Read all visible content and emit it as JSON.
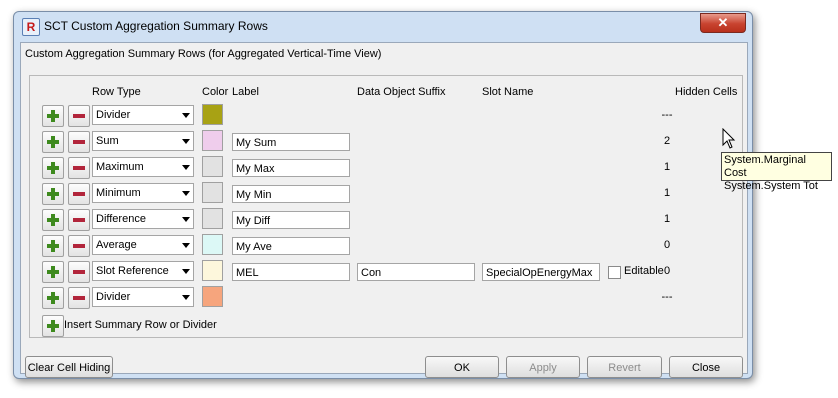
{
  "window": {
    "title": "SCT Custom Aggregation Summary Rows",
    "close_glyph": "✕",
    "app_icon_glyph": "R"
  },
  "subtitle": "Custom Aggregation Summary Rows (for Aggregated Vertical-Time View)",
  "headers": {
    "row_type": "Row Type",
    "color": "Color",
    "label": "Label",
    "suffix": "Data Object Suffix",
    "slot": "Slot Name",
    "hidden": "Hidden Cells"
  },
  "rows": [
    {
      "type": "Divider",
      "color": "#a8a214",
      "label": "",
      "suffix": "",
      "slot": "",
      "hidden": "---"
    },
    {
      "type": "Sum",
      "color": "#efcdec",
      "label": "My Sum",
      "suffix": "",
      "slot": "",
      "hidden": "2"
    },
    {
      "type": "Maximum",
      "color": "#e2e2e2",
      "label": "My Max",
      "suffix": "",
      "slot": "",
      "hidden": "1"
    },
    {
      "type": "Minimum",
      "color": "#e2e2e2",
      "label": "My Min",
      "suffix": "",
      "slot": "",
      "hidden": "1"
    },
    {
      "type": "Difference",
      "color": "#e2e2e2",
      "label": "My Diff",
      "suffix": "",
      "slot": "",
      "hidden": "1"
    },
    {
      "type": "Average",
      "color": "#dcf8f6",
      "label": "My Ave",
      "suffix": "",
      "slot": "",
      "hidden": "0"
    },
    {
      "type": "Slot Reference",
      "color": "#fdf7dc",
      "label": "MEL",
      "suffix": "Con",
      "slot": "SpecialOpEnergyMax",
      "editable_label": "Editable",
      "hidden": "0"
    },
    {
      "type": "Divider",
      "color": "#f6a57d",
      "label": "",
      "suffix": "",
      "slot": "",
      "hidden": "---"
    }
  ],
  "insert_label": "Insert Summary Row or Divider",
  "buttons": {
    "clear": "Clear Cell Hiding",
    "ok": "OK",
    "apply": "Apply",
    "revert": "Revert",
    "close": "Close"
  },
  "tooltip": {
    "line1": "System.Marginal Cost",
    "line2": "System.System Tot"
  }
}
